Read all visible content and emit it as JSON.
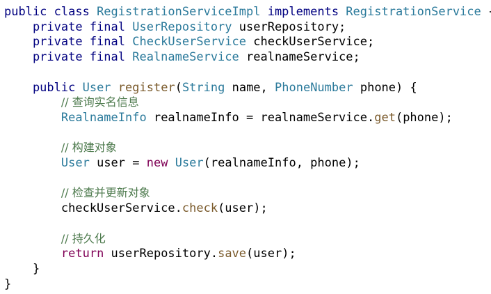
{
  "code": {
    "lines": [
      {
        "tokens": [
          {
            "text": "public class ",
            "kind": "kw"
          },
          {
            "text": "RegistrationServiceImpl",
            "kind": "type"
          },
          {
            "text": " implements ",
            "kind": "kw"
          },
          {
            "text": "RegistrationService",
            "kind": "type"
          },
          {
            "text": " {",
            "kind": "plain"
          }
        ]
      },
      {
        "tokens": [
          {
            "text": "    private final ",
            "kind": "kw"
          },
          {
            "text": "UserRepository",
            "kind": "type"
          },
          {
            "text": " userRepository;",
            "kind": "plain"
          }
        ]
      },
      {
        "tokens": [
          {
            "text": "    private final ",
            "kind": "kw"
          },
          {
            "text": "CheckUserService",
            "kind": "type"
          },
          {
            "text": " checkUserService;",
            "kind": "plain"
          }
        ]
      },
      {
        "tokens": [
          {
            "text": "    private final ",
            "kind": "kw"
          },
          {
            "text": "RealnameService",
            "kind": "type"
          },
          {
            "text": " realnameService;",
            "kind": "plain"
          }
        ]
      },
      {
        "tokens": [
          {
            "text": "",
            "kind": "plain"
          }
        ]
      },
      {
        "tokens": [
          {
            "text": "    public ",
            "kind": "kw"
          },
          {
            "text": "User",
            "kind": "type"
          },
          {
            "text": " ",
            "kind": "plain"
          },
          {
            "text": "register",
            "kind": "fn"
          },
          {
            "text": "(",
            "kind": "plain"
          },
          {
            "text": "String",
            "kind": "type"
          },
          {
            "text": " name, ",
            "kind": "plain"
          },
          {
            "text": "PhoneNumber",
            "kind": "type"
          },
          {
            "text": " phone) {",
            "kind": "plain"
          }
        ]
      },
      {
        "tokens": [
          {
            "text": "        ",
            "kind": "plain"
          },
          {
            "text": "// 查询实名信息",
            "kind": "cmt"
          }
        ]
      },
      {
        "tokens": [
          {
            "text": "        ",
            "kind": "plain"
          },
          {
            "text": "RealnameInfo",
            "kind": "type"
          },
          {
            "text": " realnameInfo = realnameService.",
            "kind": "plain"
          },
          {
            "text": "get",
            "kind": "fn"
          },
          {
            "text": "(phone);",
            "kind": "plain"
          }
        ]
      },
      {
        "tokens": [
          {
            "text": "",
            "kind": "plain"
          }
        ]
      },
      {
        "tokens": [
          {
            "text": "        ",
            "kind": "plain"
          },
          {
            "text": "// 构建对象",
            "kind": "cmt"
          }
        ]
      },
      {
        "tokens": [
          {
            "text": "        ",
            "kind": "plain"
          },
          {
            "text": "User",
            "kind": "type"
          },
          {
            "text": " user = ",
            "kind": "plain"
          },
          {
            "text": "new",
            "kind": "ret"
          },
          {
            "text": " ",
            "kind": "plain"
          },
          {
            "text": "User",
            "kind": "type"
          },
          {
            "text": "(realnameInfo, phone);",
            "kind": "plain"
          }
        ]
      },
      {
        "tokens": [
          {
            "text": "",
            "kind": "plain"
          }
        ]
      },
      {
        "tokens": [
          {
            "text": "        ",
            "kind": "plain"
          },
          {
            "text": "// 检查并更新对象",
            "kind": "cmt"
          }
        ]
      },
      {
        "tokens": [
          {
            "text": "        checkUserService.",
            "kind": "plain"
          },
          {
            "text": "check",
            "kind": "fn"
          },
          {
            "text": "(user);",
            "kind": "plain"
          }
        ]
      },
      {
        "tokens": [
          {
            "text": "",
            "kind": "plain"
          }
        ]
      },
      {
        "tokens": [
          {
            "text": "        ",
            "kind": "plain"
          },
          {
            "text": "// 持久化",
            "kind": "cmt"
          }
        ]
      },
      {
        "tokens": [
          {
            "text": "        ",
            "kind": "plain"
          },
          {
            "text": "return",
            "kind": "ret"
          },
          {
            "text": " userRepository.",
            "kind": "plain"
          },
          {
            "text": "save",
            "kind": "fn"
          },
          {
            "text": "(user);",
            "kind": "plain"
          }
        ]
      },
      {
        "tokens": [
          {
            "text": "    }",
            "kind": "plain"
          }
        ]
      },
      {
        "tokens": [
          {
            "text": "}",
            "kind": "plain"
          }
        ]
      }
    ]
  },
  "colors": {
    "background": "#ffffff",
    "keyword": "#000080",
    "control_keyword": "#7f0055",
    "type": "#2b7a9b",
    "method": "#7a5a2b",
    "comment": "#4d7a4d",
    "plain": "#000000"
  }
}
